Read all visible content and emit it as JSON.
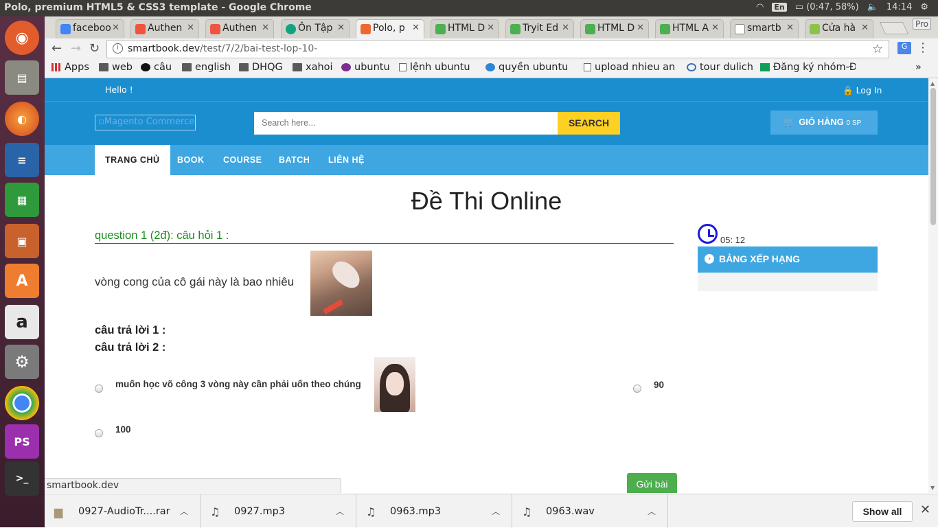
{
  "os": {
    "window_title": "Polo, premium HTML5 & CSS3 template - Google Chrome",
    "lang": "En",
    "battery": "(0:47, 58%)",
    "clock": "14:14"
  },
  "launcher": [
    "ubuntu-icon",
    "files-icon",
    "firefox-icon",
    "writer-icon",
    "calc-icon",
    "impress-icon",
    "software-center-icon",
    "amazon-icon",
    "settings-icon",
    "chrome-icon",
    "phpstorm-icon",
    "terminal-icon"
  ],
  "tabs": [
    {
      "label": "faceboo",
      "icon": "google-icon",
      "color": "#4285f4"
    },
    {
      "label": "Authen",
      "icon": "laravel-icon",
      "color": "#f05340"
    },
    {
      "label": "Authen",
      "icon": "laravel-icon",
      "color": "#f05340"
    },
    {
      "label": "Ôn Tập",
      "icon": "chatgpt-icon",
      "color": "#10a37f"
    },
    {
      "label": "Polo, p",
      "icon": "magento-icon",
      "color": "#ee672f"
    },
    {
      "label": "HTML D",
      "icon": "w3-icon",
      "color": "#4caf50"
    },
    {
      "label": "Tryit Ed",
      "icon": "w3-icon",
      "color": "#4caf50"
    },
    {
      "label": "HTML D",
      "icon": "w3-icon",
      "color": "#4caf50"
    },
    {
      "label": "HTML A",
      "icon": "w3-icon",
      "color": "#4caf50"
    },
    {
      "label": "smartb",
      "icon": "page-icon",
      "color": "#888888"
    },
    {
      "label": "Cửa hà",
      "icon": "shop-icon",
      "color": "#8bc34a"
    }
  ],
  "toolbar": {
    "url_host": "smartbook.dev",
    "url_path": "/test/7/2/bai-test-lop-10-",
    "pro_label": "Pro"
  },
  "bookmarks": [
    {
      "label": "Apps",
      "icon": "apps-icon"
    },
    {
      "label": "web",
      "icon": "folder-icon"
    },
    {
      "label": "câu",
      "icon": "github-icon"
    },
    {
      "label": "english",
      "icon": "folder-icon"
    },
    {
      "label": "DHQG",
      "icon": "folder-icon"
    },
    {
      "label": "xahoi",
      "icon": "folder-icon"
    },
    {
      "label": "ubuntu",
      "icon": "ubuntu-icon"
    },
    {
      "label": "lệnh ubuntu",
      "icon": "page-icon"
    },
    {
      "label": "quyền ubuntu",
      "icon": "ubuntu-icon"
    },
    {
      "label": "upload nhieu anh",
      "icon": "page-icon"
    },
    {
      "label": "tour dulich",
      "icon": "site-icon"
    },
    {
      "label": "Đăng ký nhóm-Đ",
      "icon": "sheets-icon"
    }
  ],
  "site": {
    "hello": "Hello !",
    "login": "Log In",
    "logo_alt": "Magento Commerce",
    "search_placeholder": "Search here...",
    "search_button": "SEARCH",
    "cart_label": "GIỎ HÀNG",
    "cart_count": "0 SP",
    "nav": [
      "TRANG CHỦ",
      "BOOK",
      "COURSE",
      "BATCH",
      "LIÊN HỆ"
    ],
    "page_title": "Đề Thi Online",
    "question_header": "question  1 (2đ):  câu hỏi 1 :",
    "question_text": "vòng cong của cô gái này là bao nhiêu",
    "answer1": "câu trả lời 1 :",
    "answer2": "câu trả lời 2 :",
    "options": [
      "muốn học võ công 3 vòng này cần phải uốn theo chúng",
      "90",
      "100"
    ],
    "timer": "05: 12",
    "ranking_title": "BẢNG XẾP HẠNG",
    "submit": "Gửi bài",
    "status_url": "smartbook.dev"
  },
  "downloads": [
    {
      "name": "0927-AudioTr....rar",
      "icon": "archive-icon"
    },
    {
      "name": "0927.mp3",
      "icon": "music-icon"
    },
    {
      "name": "0963.mp3",
      "icon": "music-icon"
    },
    {
      "name": "0963.wav",
      "icon": "music-icon"
    }
  ],
  "downloads_show_all": "Show all"
}
